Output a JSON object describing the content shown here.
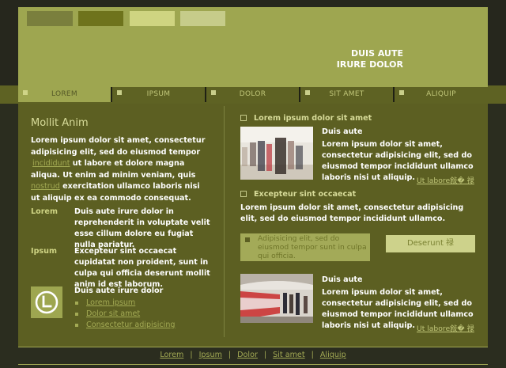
{
  "header": {
    "tagline_line1": "DUIS AUTE",
    "tagline_line2": "IRURE DOLOR"
  },
  "nav": {
    "items": [
      {
        "label": "LOREM"
      },
      {
        "label": "IPSUM"
      },
      {
        "label": "DOLOR"
      },
      {
        "label": "SIT AMET"
      },
      {
        "label": "ALIQUIP"
      }
    ]
  },
  "left": {
    "title": "Mollit Anim",
    "para_part1": "Lorem ipsum dolor sit amet, consectetur adipisicing elit, sed do eiusmod tempor",
    "para_link1": "incididunt",
    "para_part2": " ut labore et dolore magna aliqua. Ut enim ad minim veniam, quis ",
    "para_link2": "nostrud",
    "para_part3": " exercitation ullamco laboris nisi ut aliquip ex ea commodo consequat.",
    "defs": [
      {
        "term": "Lorem",
        "desc": "Duis aute irure dolor in reprehenderit in voluptate velit esse cillum dolore eu fugiat nulla pariatur."
      },
      {
        "term": "Ipsum",
        "desc": "Excepteur sint occaecat cupidatat non proident, sunt in culpa qui officia deserunt mollit anim id est laborum."
      }
    ],
    "list_title": "Duis aute irure dolor",
    "links": [
      "Lorem ipsum",
      "Dolor sit amet",
      "Consectetur adipisicing"
    ]
  },
  "right": {
    "section1_title": "Lorem ipsum dolor sit amet",
    "item1_title": "Duis aute",
    "item1_text": "Lorem ipsum dolor sit amet, consectetur adipisicing elit, sed do eiusmod tempor incididunt ullamco laboris nisi ut aliquip.",
    "item1_more": "Ut labore敍� 禄",
    "section2_title": "Excepteur sint occaecat",
    "section2_text": "Lorem ipsum dolor sit amet, consectetur adipisicing elit, sed do eiusmod tempor incididunt ullamco.",
    "highlight_text": "Adipisicing elit, sed do eiusmod tempor sunt in culpa qui officia.",
    "button_label": "Deserunt 禄",
    "item2_title": "Duis aute",
    "item2_text": "Lorem ipsum dolor sit amet, consectetur adipisicing elit, sed do eiusmod tempor incididunt ullamco laboris nisi ut aliquip.",
    "item2_more": "Ut labore敍� 禄"
  },
  "footer": {
    "links": [
      "Lorem",
      "Ipsum",
      "Dolor",
      "Sit amet",
      "Aliquip"
    ],
    "separator": "|"
  },
  "colors": {
    "header_bg": "#9ea650",
    "main_bg": "#5c5f22",
    "link": "#a3aa54",
    "page_bg": "#2b2d1f"
  }
}
